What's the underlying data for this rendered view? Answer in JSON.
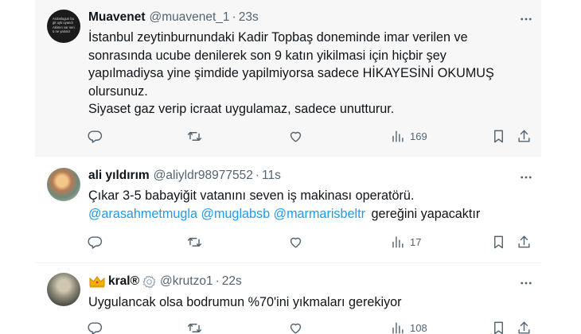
{
  "tweets": [
    {
      "name": "Muavenet",
      "handle": "@muavenet_1",
      "time": "23s",
      "lines": [
        "İstanbul zeytinburnundaki Kadir Topbaş doneminde imar verilen ve",
        "sonrasında ucube denilerek son 9 katın yikilmasi için hiçbir şey",
        "yapılmadiysa yine şimdide yapilmiyorsa sadece HİKAYESİNİ OKUMUŞ",
        "olursunuz.",
        "Siyaset gaz verip icraat uygulamaz, sadece unutturur."
      ],
      "avatar_text": "Ardoslugun bu git uyk uyandı Aklının var sen ü ne yaloniz",
      "views": "169"
    },
    {
      "name": "ali yıldırım",
      "handle": "@aliyldr98977552",
      "time": "11s",
      "line1": "Çıkar 3-5 babayiğit vatanını seven iş makinası operatörü.",
      "mentions": [
        "@arasahmetmugla",
        "@muglabsb",
        "@marmarisbeltr"
      ],
      "line2_tail": "gereğini yapacaktır",
      "views": "17"
    },
    {
      "name": "kral®",
      "handle": "@krutzo1",
      "time": "22s",
      "line1": "Uygulancak olsa bodrumun %70'ini yıkmaları gerekiyor",
      "views": "108"
    }
  ],
  "separator": "·",
  "icons": {
    "more": "more-horizontal-icon",
    "reply": "reply-icon",
    "retweet": "retweet-icon",
    "like": "like-icon",
    "views": "views-icon",
    "bookmark": "bookmark-icon",
    "share": "share-icon",
    "crown": "crown-icon",
    "verified": "verified-badge-icon"
  },
  "colors": {
    "link": "#1d9bf0",
    "muted": "#536471",
    "text": "#0f1419",
    "highlight": "#f7f7f7"
  }
}
